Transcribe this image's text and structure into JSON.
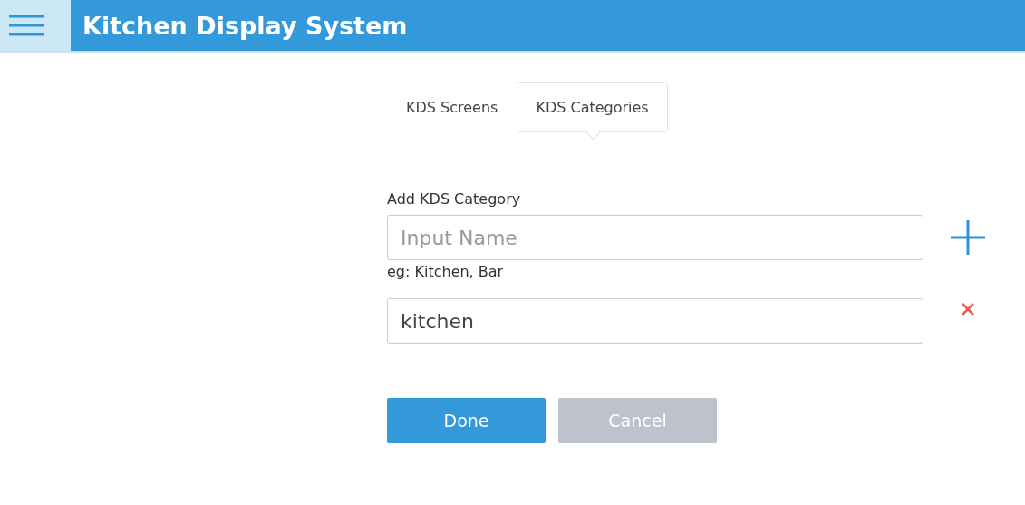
{
  "header": {
    "title": "Kitchen Display System"
  },
  "tabs": [
    {
      "label": "KDS Screens",
      "selected": false
    },
    {
      "label": "KDS Categories",
      "selected": true
    }
  ],
  "add_category": {
    "label": "Add KDS Category",
    "placeholder": "Input Name",
    "hint": "eg: Kitchen, Bar"
  },
  "categories": [
    {
      "value": "kitchen"
    }
  ],
  "buttons": [
    {
      "label": "Done",
      "kind": "primary"
    },
    {
      "label": "Cancel",
      "kind": "secondary"
    }
  ]
}
